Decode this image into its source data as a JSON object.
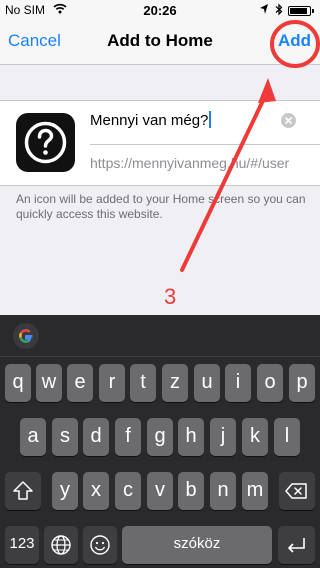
{
  "status_bar": {
    "carrier": "No SIM",
    "time": "20:26",
    "battery_fraction": 0.9
  },
  "nav": {
    "cancel_label": "Cancel",
    "title": "Add to Home",
    "add_label": "Add"
  },
  "bookmark": {
    "name_value": "Mennyi van még?",
    "url": "https://mennyivanmeg.hu/#/user",
    "icon": "question-mark-icon"
  },
  "hint_text": "An icon will be added to your Home screen so you can quickly access this website.",
  "annotation": {
    "step_number": "3",
    "color": "#f03a3a"
  },
  "keyboard": {
    "row1": [
      "q",
      "w",
      "e",
      "r",
      "t",
      "z",
      "u",
      "i",
      "o",
      "p"
    ],
    "row2": [
      "a",
      "s",
      "d",
      "f",
      "g",
      "h",
      "j",
      "k",
      "l"
    ],
    "row3": [
      "y",
      "x",
      "c",
      "v",
      "b",
      "n",
      "m"
    ],
    "numbers_label": "123",
    "space_label": "szóköz"
  },
  "colors": {
    "accent": "#1a82fb",
    "keyboard_bg": "#2a2a2c",
    "key_bg": "#6b6b6e"
  }
}
